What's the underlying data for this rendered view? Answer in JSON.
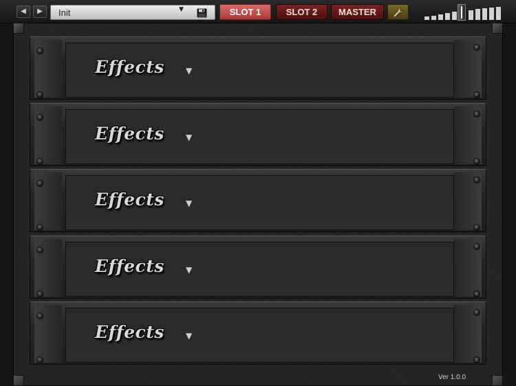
{
  "toolbar": {
    "preset": {
      "name": "Init"
    },
    "tabs": [
      {
        "label": "SLOT 1",
        "active": true
      },
      {
        "label": "SLOT 2",
        "active": false
      },
      {
        "label": "MASTER",
        "active": false
      }
    ],
    "icons": {
      "prev": "left-triangle-icon",
      "next": "right-triangle-icon",
      "dropdown": "dropdown-triangle-icon",
      "save": "floppy-disk-icon",
      "settings": "wrench-icon"
    },
    "volume_level": 0.5
  },
  "rack": {
    "slots": [
      {
        "label": "Effects"
      },
      {
        "label": "Effects"
      },
      {
        "label": "Effects"
      },
      {
        "label": "Effects"
      },
      {
        "label": "Effects"
      }
    ]
  },
  "footer": {
    "version": "Ver 1.0.0"
  },
  "colors": {
    "active_tab": "#c65454",
    "inactive_tab": "#641b1b",
    "tool_button": "#6a5a20",
    "background": "#141414"
  }
}
